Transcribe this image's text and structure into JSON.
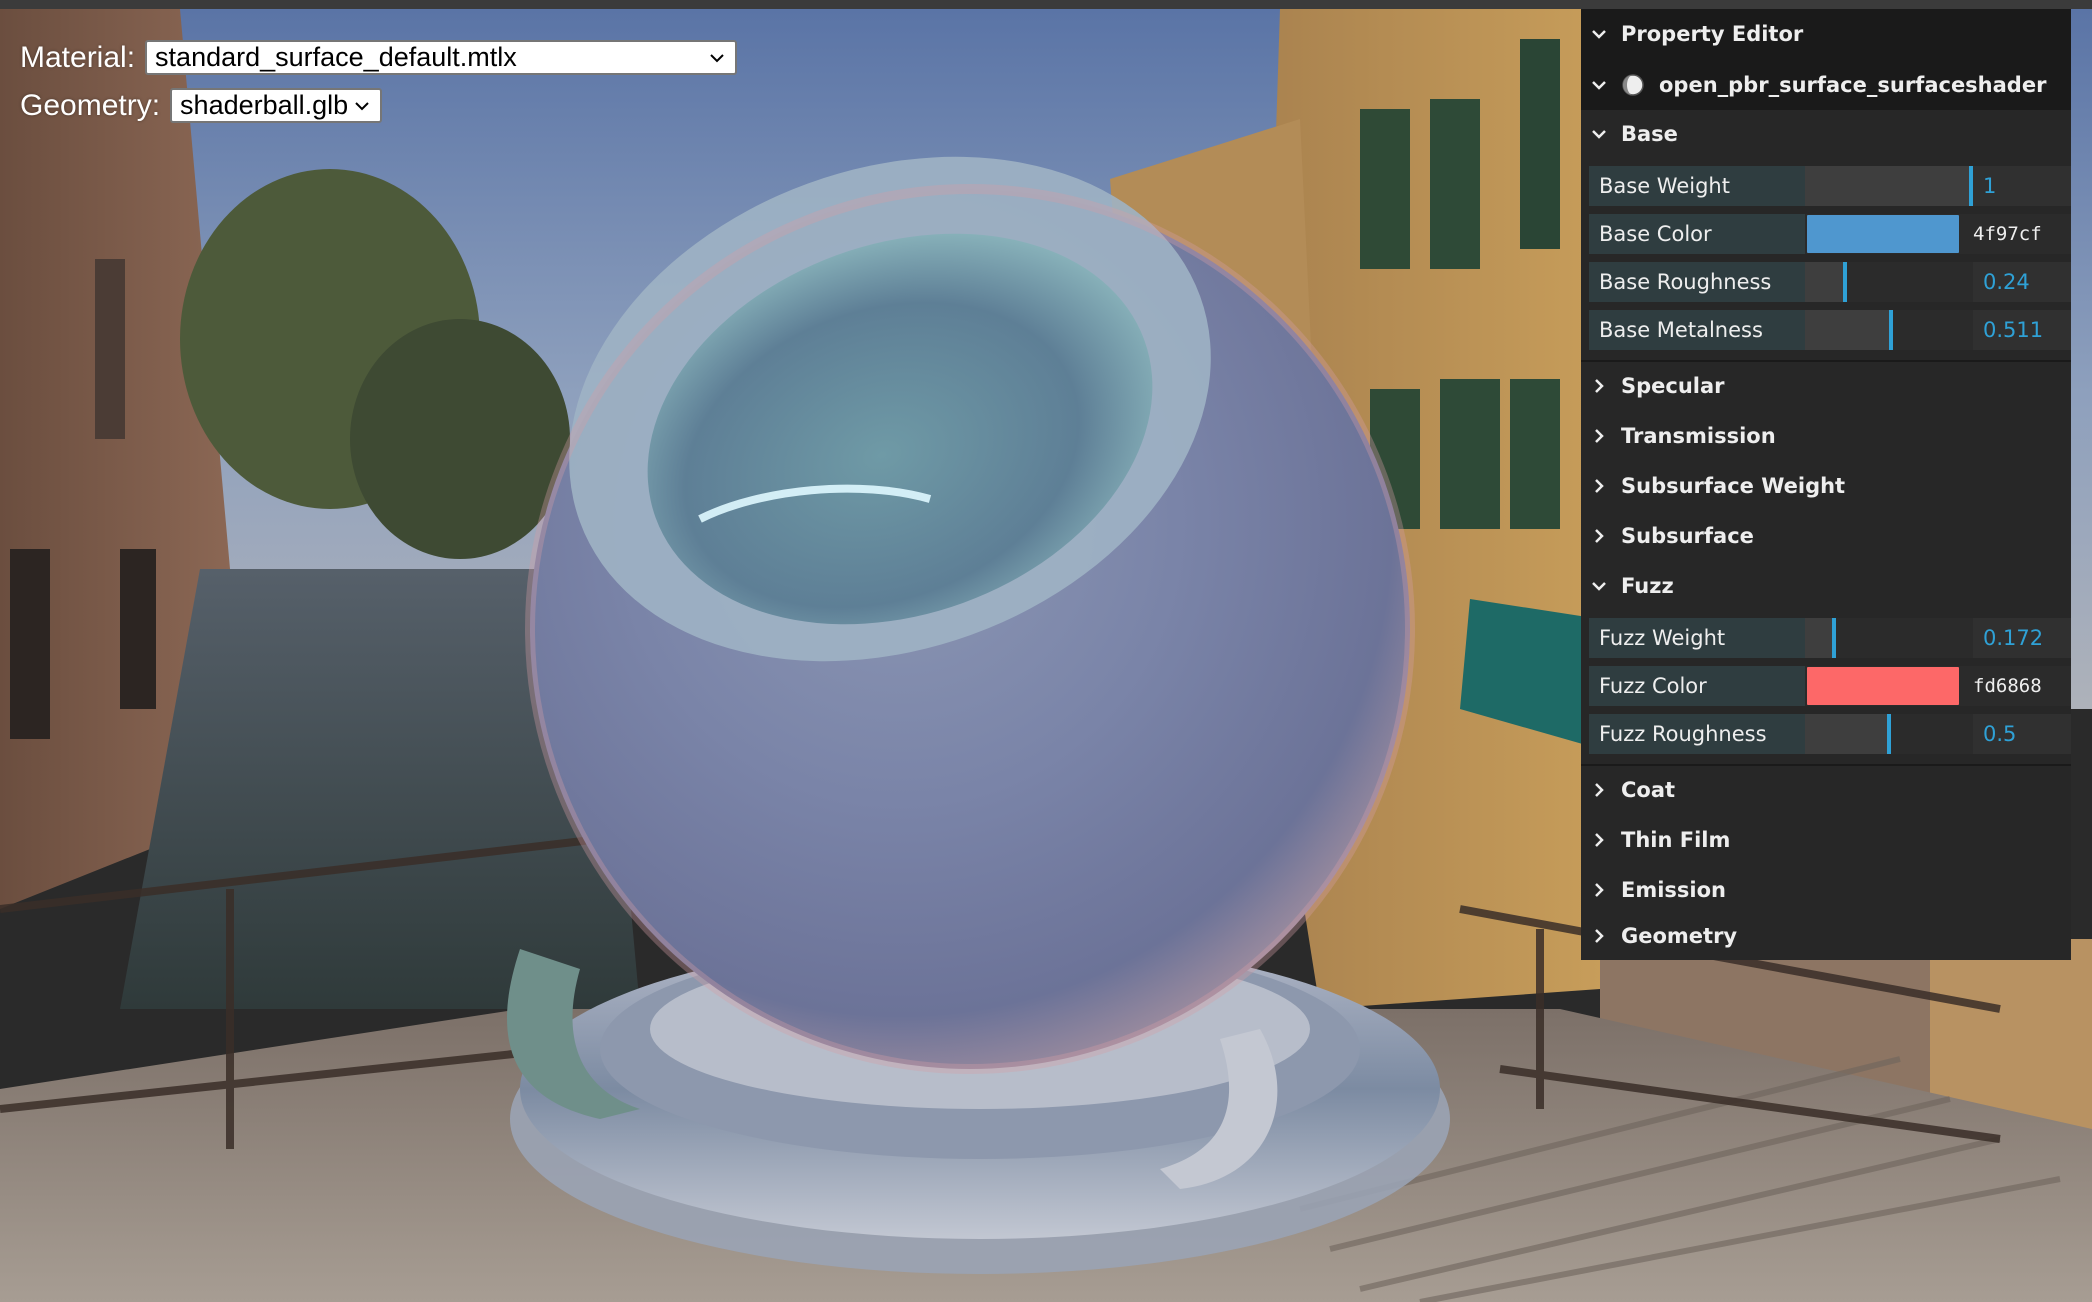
{
  "controls": {
    "material_label": "Material:",
    "material_value": "standard_surface_default.mtlx",
    "geometry_label": "Geometry:",
    "geometry_value": "shaderball.glb"
  },
  "property_editor": {
    "title": "Property Editor",
    "shader_name": "open_pbr_surface_surfaceshader",
    "folders": [
      {
        "label": "Base",
        "expanded": true,
        "properties": [
          {
            "label": "Base Weight",
            "type": "number",
            "value": "1",
            "fraction": 1.0
          },
          {
            "label": "Base Color",
            "type": "color",
            "value": "4f97cf",
            "color": "#4f97cf"
          },
          {
            "label": "Base Roughness",
            "type": "number",
            "value": "0.24",
            "fraction": 0.24
          },
          {
            "label": "Base Metalness",
            "type": "number",
            "value": "0.511",
            "fraction": 0.511
          }
        ]
      },
      {
        "label": "Specular",
        "expanded": false
      },
      {
        "label": "Transmission",
        "expanded": false
      },
      {
        "label": "Subsurface Weight",
        "expanded": false
      },
      {
        "label": "Subsurface",
        "expanded": false
      },
      {
        "label": "Fuzz",
        "expanded": true,
        "properties": [
          {
            "label": "Fuzz Weight",
            "type": "number",
            "value": "0.172",
            "fraction": 0.172
          },
          {
            "label": "Fuzz Color",
            "type": "color",
            "value": "fd6868",
            "color": "#fd6868"
          },
          {
            "label": "Fuzz Roughness",
            "type": "number",
            "value": "0.5",
            "fraction": 0.5
          }
        ]
      },
      {
        "label": "Coat",
        "expanded": false
      },
      {
        "label": "Thin Film",
        "expanded": false
      },
      {
        "label": "Emission",
        "expanded": false
      },
      {
        "label": "Geometry",
        "expanded": false
      }
    ]
  },
  "colors": {
    "accent": "#2fa1d6",
    "panel_bg": "#272727",
    "header_bg": "#1a1a1a"
  },
  "icons": {
    "expanded": "chevron-down-icon",
    "collapsed": "chevron-right-icon",
    "shader": "sphere-icon",
    "dropdown": "chevron-down-icon"
  }
}
